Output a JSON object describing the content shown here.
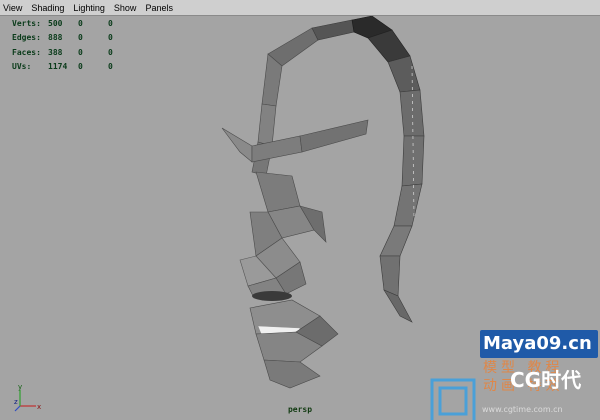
{
  "menubar": {
    "items": [
      "View",
      "Shading",
      "Lighting",
      "Show",
      "Panels"
    ]
  },
  "hud": {
    "rows": [
      {
        "label": "Verts:",
        "v1": "500",
        "v2": "0",
        "v3": "0"
      },
      {
        "label": "Edges:",
        "v1": "888",
        "v2": "0",
        "v3": "0"
      },
      {
        "label": "Faces:",
        "v1": "388",
        "v2": "0",
        "v3": "0"
      },
      {
        "label": "UVs:",
        "v1": "1174",
        "v2": "0",
        "v3": "0"
      }
    ]
  },
  "camera_label": "persp",
  "axis": {
    "x": "x",
    "y": "y",
    "z": "z"
  },
  "watermark": {
    "brand": "Maya09.cn",
    "line1": "模型 教程",
    "line2": "动画 特效",
    "cg": "CG时代",
    "url": "www.cgtime.com.cn"
  },
  "colors": {
    "background": "#a4a4a4",
    "hud_text": "#0a3b1a",
    "brand_box": "#1f5aa8"
  }
}
